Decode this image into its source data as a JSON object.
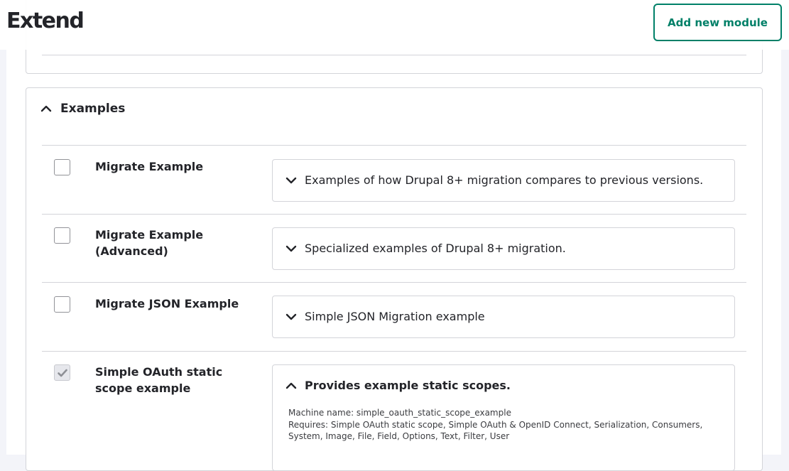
{
  "header": {
    "title": "Extend",
    "add_button_label": "Add new module"
  },
  "examples_group": {
    "legend": "Examples",
    "modules": [
      {
        "name": "Migrate Example",
        "checked": false,
        "description": "Examples of how Drupal 8+ migration compares to previous versions.",
        "expanded": false
      },
      {
        "name": "Migrate Example (Advanced)",
        "checked": false,
        "description": "Specialized examples of Drupal 8+ migration.",
        "expanded": false
      },
      {
        "name": "Migrate JSON Example",
        "checked": false,
        "description": "Simple JSON Migration example",
        "expanded": false
      },
      {
        "name": "Simple OAuth static scope example",
        "checked": true,
        "description": "Provides example static scopes.",
        "expanded": true,
        "machine_name_line": "Machine name: simple_oauth_static_scope_example",
        "requires_line": "Requires: Simple OAuth static scope, Simple OAuth & OpenID Connect, Serialization, Consumers, System, Image, File, Field, Options, Text, Filter, User"
      }
    ]
  },
  "colors": {
    "accent": "#008068",
    "text": "#232429",
    "border": "#d3d4d9",
    "background": "#f3f4f9"
  }
}
